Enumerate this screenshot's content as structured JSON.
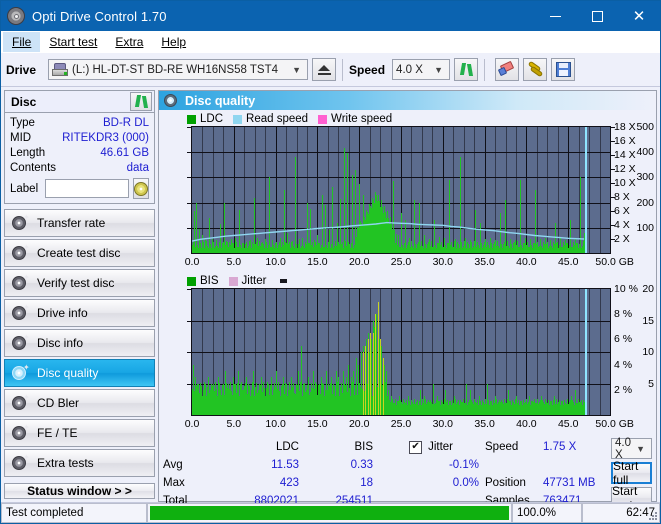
{
  "window": {
    "title": "Opti Drive Control 1.70",
    "icon": "disc-icon",
    "minimize_label": "–",
    "maximize_label": "□",
    "close_label": "✕"
  },
  "menu": {
    "items": [
      {
        "label": "File",
        "active": true
      },
      {
        "label": "Start test",
        "active": false
      },
      {
        "label": "Extra",
        "active": false
      },
      {
        "label": "Help",
        "active": false
      }
    ]
  },
  "toolbar": {
    "drive_label": "Drive",
    "drive_value": "(L:)  HL-DT-ST BD-RE  WH16NS58 TST4",
    "eject_label": "eject-button",
    "speed_label": "Speed",
    "speed_value": "4.0 X",
    "refresh_label": "refresh-button",
    "eraser_label": "erase-button",
    "tools_label": "tools-button",
    "save_label": "save-button"
  },
  "sidebar": {
    "disc_panel": {
      "title": "Disc",
      "refresh_label": "refresh-disc-button",
      "rows": [
        {
          "key": "Type",
          "value": "BD-R DL"
        },
        {
          "key": "MID",
          "value": "RITEKDR3 (000)"
        },
        {
          "key": "Length",
          "value": "46.61 GB"
        },
        {
          "key": "Contents",
          "value": "data"
        }
      ],
      "label_key": "Label",
      "label_value": "",
      "label_placeholder": "",
      "disc_button_label": "disc-info-button"
    },
    "nav": [
      {
        "label": "Transfer rate",
        "selected": false
      },
      {
        "label": "Create test disc",
        "selected": false
      },
      {
        "label": "Verify test disc",
        "selected": false
      },
      {
        "label": "Drive info",
        "selected": false
      },
      {
        "label": "Disc info",
        "selected": false
      },
      {
        "label": "Disc quality",
        "selected": true
      },
      {
        "label": "CD Bler",
        "selected": false
      },
      {
        "label": "FE / TE",
        "selected": false
      },
      {
        "label": "Extra tests",
        "selected": false
      }
    ],
    "status_window_button": "Status window > >"
  },
  "main": {
    "header_title": "Disc quality",
    "header_icon": "disc-quality-icon"
  },
  "stats": {
    "headers": {
      "blank": "",
      "ldc": "LDC",
      "bis": "BIS",
      "jitter": "Jitter"
    },
    "jitter_checkbox_checked": true,
    "jitter_check_glyph": "✔",
    "rows": [
      {
        "label": "Avg",
        "ldc": "11.53",
        "bis": "0.33",
        "jitter": "-0.1%"
      },
      {
        "label": "Max",
        "ldc": "423",
        "bis": "18",
        "jitter": "0.0%"
      },
      {
        "label": "Total",
        "ldc": "8802021",
        "bis": "254511",
        "jitter": ""
      }
    ],
    "meta": [
      {
        "label": "Speed",
        "value": "1.75 X"
      },
      {
        "label": "Position",
        "value": "47731 MB"
      },
      {
        "label": "Samples",
        "value": "763471"
      }
    ],
    "speed_select_value": "4.0 X",
    "start_full_label": "Start full",
    "start_part_label": "Start part"
  },
  "statusbar": {
    "message": "Test completed",
    "progress_percent": "100.0%",
    "progress_value": 100,
    "elapsed": "62:47"
  },
  "colors": {
    "accent_blue": "#0b63b0",
    "value_blue": "#1d1dd1",
    "plot_bg": "#5c6c8e",
    "ldc_green": "#22c423",
    "bis_green": "#22c423",
    "read_speed": "#8fd6f0",
    "write_speed": "#ff5fd0",
    "jitter_pink": "#d9a8d2",
    "progress_green": "#0fb00f",
    "selected_nav": "#18a6e4"
  },
  "chart_data": [
    {
      "type": "bar",
      "name": "ldc-chart",
      "title": "Disc quality",
      "xlabel": "GB",
      "ylabel": "",
      "xlim": [
        0,
        50
      ],
      "ylim": [
        0,
        500
      ],
      "y_ticks": [
        100,
        200,
        300,
        400,
        500
      ],
      "y2lim": [
        0,
        18
      ],
      "y2_ticks": [
        2,
        4,
        6,
        8,
        10,
        12,
        14,
        16,
        18
      ],
      "y2label": "X",
      "x_ticks": [
        0.0,
        5.0,
        10.0,
        15.0,
        20.0,
        25.0,
        30.0,
        35.0,
        40.0,
        45.0,
        50.0
      ],
      "x_tick_labels": [
        "0.0",
        "5.0",
        "10.0",
        "15.0",
        "20.0",
        "25.0",
        "30.0",
        "35.0",
        "40.0",
        "45.0",
        "50.0 GB"
      ],
      "grid": true,
      "legend": [
        {
          "label": "LDC",
          "color": "#00a000"
        },
        {
          "label": "Read speed",
          "color": "#8fd6f0"
        },
        {
          "label": "Write speed",
          "color": "#ff5fd0"
        }
      ],
      "series": [
        {
          "name": "LDC",
          "type": "bar",
          "color": "#22c423",
          "x": [
            0.2,
            0.5,
            0.8,
            1.2,
            1.6,
            2.0,
            2.4,
            2.9,
            3.3,
            3.8,
            4.2,
            4.7,
            5.1,
            5.6,
            6.0,
            6.5,
            6.9,
            7.4,
            7.8,
            8.3,
            8.7,
            9.2,
            9.6,
            10.1,
            10.5,
            11.0,
            11.4,
            11.9,
            12.3,
            12.8,
            13.2,
            13.7,
            14.1,
            14.6,
            15.0,
            15.5,
            15.9,
            16.4,
            16.8,
            17.3,
            17.7,
            18.2,
            18.6,
            19.1,
            19.5,
            20.0,
            20.4,
            20.8,
            21.1,
            21.4,
            21.6,
            21.8,
            22.0,
            22.2,
            22.4,
            22.6,
            22.8,
            23.0,
            23.2,
            23.5,
            23.8,
            24.1,
            24.4,
            24.7,
            25.0,
            25.5,
            26.0,
            26.6,
            27.2,
            27.8,
            28.4,
            29.0,
            29.6,
            30.2,
            30.8,
            31.4,
            32.0,
            32.6,
            33.2,
            33.8,
            34.4,
            35.0,
            35.6,
            36.2,
            36.8,
            37.4,
            38.0,
            38.6,
            39.2,
            39.8,
            40.4,
            41.0,
            41.6,
            42.2,
            42.8,
            43.4,
            44.0,
            44.6,
            45.2,
            45.8,
            46.4,
            46.9
          ],
          "values": [
            165,
            200,
            95,
            70,
            60,
            140,
            55,
            50,
            115,
            200,
            45,
            55,
            60,
            170,
            40,
            45,
            50,
            220,
            60,
            40,
            55,
            300,
            50,
            45,
            60,
            250,
            80,
            45,
            380,
            55,
            60,
            200,
            175,
            50,
            70,
            230,
            190,
            90,
            260,
            120,
            215,
            415,
            395,
            310,
            330,
            275,
            230,
            160,
            150,
            180,
            125,
            140,
            120,
            100,
            135,
            95,
            120,
            110,
            100,
            90,
            80,
            285,
            75,
            70,
            160,
            130,
            60,
            210,
            200,
            70,
            55,
            130,
            65,
            60,
            290,
            55,
            380,
            60,
            50,
            170,
            120,
            55,
            60,
            50,
            160,
            210,
            55,
            50,
            290,
            60,
            55,
            250,
            55,
            60,
            50,
            120,
            60,
            50,
            130,
            60,
            300,
            80
          ]
        },
        {
          "name": "Read speed",
          "type": "line",
          "color": "#8fd6f0",
          "x": [
            0.0,
            1.0,
            2.0,
            3.0,
            4.0,
            5.0,
            6.0,
            7.0,
            8.0,
            9.0,
            10.0,
            11.0,
            12.0,
            13.0,
            14.0,
            15.0,
            16.0,
            17.0,
            18.0,
            19.0,
            20.0,
            21.0,
            22.0,
            23.0,
            23.3,
            24.0,
            25.0,
            26.0,
            27.0,
            28.0,
            29.0,
            30.0,
            31.0,
            32.0,
            33.0,
            34.0,
            35.0,
            36.0,
            37.0,
            38.0,
            39.0,
            40.0,
            41.0,
            42.0,
            43.0,
            44.0,
            45.0,
            46.0,
            46.9
          ],
          "values": [
            1.7,
            1.95,
            2.1,
            2.25,
            2.4,
            2.5,
            2.6,
            2.7,
            2.8,
            2.9,
            3.0,
            3.1,
            3.2,
            3.3,
            3.4,
            3.5,
            3.6,
            3.65,
            3.75,
            3.85,
            3.95,
            4.05,
            4.15,
            4.3,
            4.35,
            4.3,
            4.25,
            4.2,
            4.1,
            4.05,
            4.0,
            3.95,
            3.8,
            3.7,
            3.55,
            3.4,
            3.3,
            3.2,
            3.05,
            2.9,
            2.8,
            2.65,
            2.5,
            2.4,
            2.3,
            2.2,
            2.1,
            2.05,
            2.0
          ]
        },
        {
          "name": "Write speed",
          "type": "line",
          "color": "#ff5fd0",
          "x": [],
          "values": []
        }
      ],
      "cursor_x": 47.0
    },
    {
      "type": "bar",
      "name": "bis-jitter-chart",
      "xlabel": "GB",
      "xlim": [
        0,
        50
      ],
      "ylim": [
        0,
        20
      ],
      "y_ticks": [
        5,
        10,
        15,
        20
      ],
      "y2lim": [
        0,
        10
      ],
      "y2_ticks": [
        2,
        4,
        6,
        8,
        10
      ],
      "y2label": "%",
      "x_ticks": [
        0.0,
        5.0,
        10.0,
        15.0,
        20.0,
        25.0,
        30.0,
        35.0,
        40.0,
        45.0,
        50.0
      ],
      "x_tick_labels": [
        "0.0",
        "5.0",
        "10.0",
        "15.0",
        "20.0",
        "25.0",
        "30.0",
        "35.0",
        "40.0",
        "45.0",
        "50.0 GB"
      ],
      "grid": true,
      "legend": [
        {
          "label": "BIS",
          "color": "#00a000"
        },
        {
          "label": "Jitter",
          "color": "#d9a8d2"
        }
      ],
      "series": [
        {
          "name": "BIS",
          "type": "bar",
          "color": "#22c423",
          "x": [
            0.1,
            0.4,
            0.7,
            1.0,
            1.3,
            1.6,
            1.9,
            2.2,
            2.5,
            2.8,
            3.1,
            3.4,
            3.7,
            4.0,
            4.3,
            4.6,
            4.9,
            5.2,
            5.5,
            5.8,
            6.1,
            6.4,
            6.7,
            7.0,
            7.3,
            7.6,
            7.9,
            8.2,
            8.5,
            8.8,
            9.1,
            9.4,
            9.7,
            10.0,
            10.3,
            10.6,
            10.9,
            11.2,
            11.5,
            11.8,
            12.1,
            12.4,
            12.7,
            13.0,
            13.3,
            13.6,
            13.9,
            14.2,
            14.5,
            14.8,
            15.1,
            15.4,
            15.7,
            16.0,
            16.3,
            16.6,
            16.9,
            17.2,
            17.5,
            17.8,
            18.1,
            18.4,
            18.7,
            19.0,
            19.3,
            19.6,
            19.9,
            20.2,
            20.5,
            20.8,
            21.0,
            21.2,
            21.4,
            21.6,
            21.8,
            22.0,
            22.2,
            22.4,
            22.6,
            22.8,
            23.0,
            23.2,
            23.4,
            23.8,
            24.3,
            24.8,
            25.3,
            25.8,
            26.3,
            26.8,
            27.3,
            27.8,
            28.3,
            28.8,
            29.3,
            29.8,
            30.3,
            30.8,
            31.3,
            31.8,
            32.3,
            32.8,
            33.3,
            33.8,
            34.3,
            34.8,
            35.3,
            35.8,
            36.3,
            36.8,
            37.3,
            37.8,
            38.3,
            38.8,
            39.3,
            39.8,
            40.3,
            40.8,
            41.3,
            41.8,
            42.3,
            42.8,
            43.3,
            43.8,
            44.3,
            44.8,
            45.3,
            45.8,
            46.3,
            46.8
          ],
          "values": [
            8,
            6,
            5,
            5,
            4,
            5,
            6,
            4,
            5,
            4,
            6,
            4,
            5,
            7,
            5,
            4,
            6,
            5,
            7,
            5,
            4,
            6,
            5,
            4,
            7,
            5,
            4,
            6,
            5,
            4,
            5,
            6,
            4,
            7,
            5,
            4,
            6,
            5,
            4,
            6,
            5,
            4,
            7,
            11,
            5,
            4,
            6,
            5,
            7,
            5,
            4,
            6,
            5,
            7,
            5,
            6,
            5,
            7,
            6,
            5,
            7,
            6,
            8,
            6,
            7,
            9,
            8,
            10,
            11,
            12,
            13,
            10,
            12,
            15,
            14,
            16,
            18,
            12,
            11,
            9,
            8,
            7,
            4,
            3,
            2,
            3,
            2,
            3,
            2,
            2,
            4,
            3,
            2,
            5,
            3,
            2,
            4,
            2,
            3,
            2,
            2,
            5,
            4,
            2,
            3,
            2,
            5,
            2,
            3,
            2,
            2,
            4,
            2,
            3,
            2,
            2,
            3,
            2,
            2,
            3,
            2,
            2,
            3,
            2,
            2,
            2,
            3,
            4,
            2,
            2
          ]
        },
        {
          "name": "Jitter",
          "type": "bar",
          "color": "#c9d41f",
          "x": [
            20.4,
            20.7,
            21.0,
            21.3,
            21.6,
            21.9,
            22.2,
            22.5,
            22.8
          ],
          "values": [
            10,
            11,
            12,
            13,
            13,
            16,
            18,
            12,
            9
          ]
        }
      ],
      "cursor_x": 47.0
    }
  ]
}
